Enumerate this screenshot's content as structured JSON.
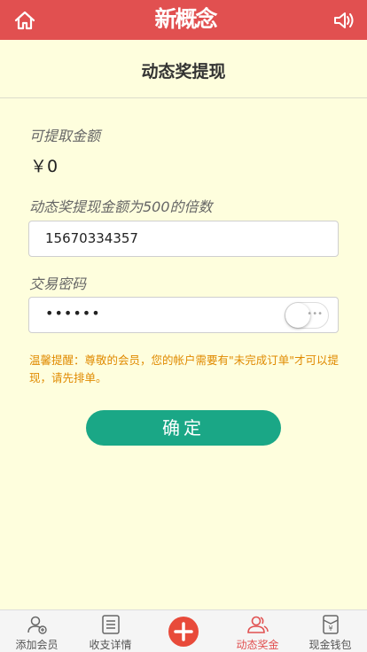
{
  "header": {
    "logo_text": "新概念",
    "home_icon": "home-icon",
    "sound_icon": "speaker-icon"
  },
  "page": {
    "title": "动态奖提现"
  },
  "form": {
    "available_label": "可提取金额",
    "available_amount": "￥0",
    "multiple_label": "动态奖提现金额为500的倍数",
    "phone_value": "15670334357",
    "password_label": "交易密码",
    "password_value": "••••••",
    "notice": "温馨提醒：尊敬的会员，您的帐户需要有\"未完成订单\"才可以提现，请先排单。",
    "confirm_label": "确定"
  },
  "tabs": [
    {
      "label": "添加会员",
      "icon": "add-user-icon"
    },
    {
      "label": "收支详情",
      "icon": "list-icon"
    },
    {
      "label": "",
      "icon": "plus-icon"
    },
    {
      "label": "动态奖金",
      "icon": "users-icon",
      "active": true
    },
    {
      "label": "现金钱包",
      "icon": "wallet-icon"
    }
  ],
  "colors": {
    "header_bg": "#e15050",
    "page_bg": "#fefedd",
    "button": "#1aa786",
    "notice": "#e08a00",
    "active_tab": "#e15050"
  }
}
